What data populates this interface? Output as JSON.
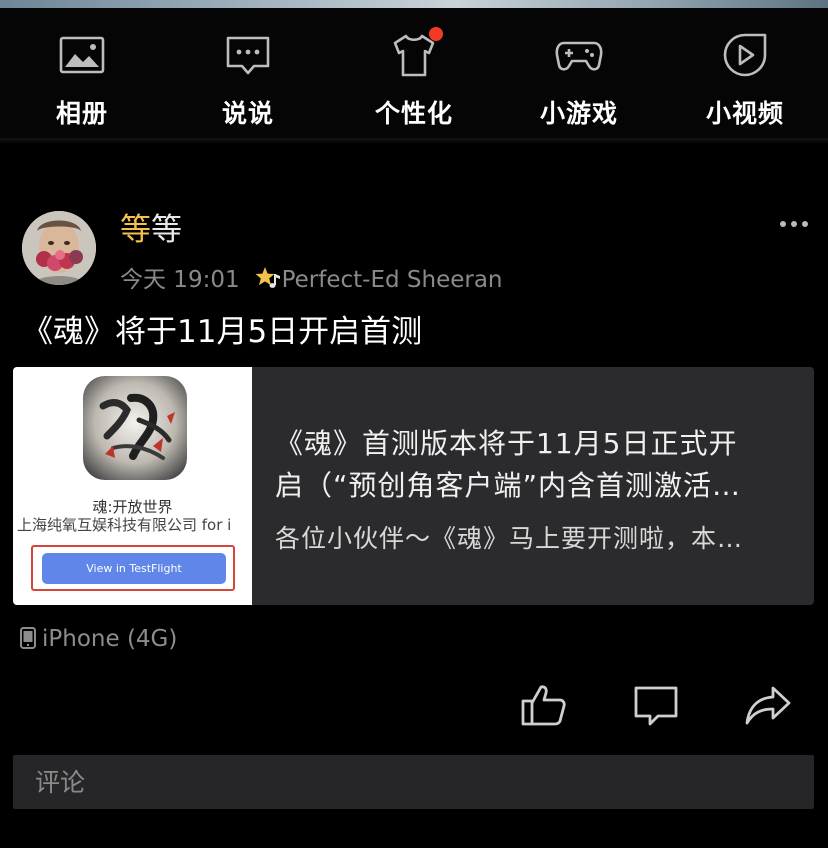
{
  "quick_nav": [
    {
      "label": "相册",
      "icon": "photo-album-icon"
    },
    {
      "label": "说说",
      "icon": "chat-bubble-icon"
    },
    {
      "label": "个性化",
      "icon": "tshirt-icon",
      "badge": true
    },
    {
      "label": "小游戏",
      "icon": "gamepad-icon"
    },
    {
      "label": "小视频",
      "icon": "play-video-icon"
    }
  ],
  "post": {
    "username_first": "等",
    "username_rest": "等",
    "time": "今天 19:01",
    "tag": "Perfect-Ed Sheeran",
    "text": "《魂》将于11月5日开启首测",
    "device": "iPhone (4G)"
  },
  "share_card": {
    "thumb_title": "魂:开放世界",
    "thumb_subtitle": "上海纯氧互娱科技有限公司 for i",
    "thumb_button": "View in TestFlight",
    "title_line1": "《魂》首测版本将于11月5日正式开",
    "title_line2": "启（“预创角客户端”内含首测激活…",
    "description": "各位小伙伴～《魂》马上要开测啦，本…"
  },
  "actions": [
    "thumbs-up-icon",
    "comment-icon",
    "share-icon"
  ],
  "comment": {
    "placeholder": "评论"
  },
  "colors": {
    "background": "#000000",
    "card": "#2b2b2d",
    "username_accent": "#f2c14e",
    "badge": "#f33a24",
    "button_blue": "#5f86e8"
  }
}
